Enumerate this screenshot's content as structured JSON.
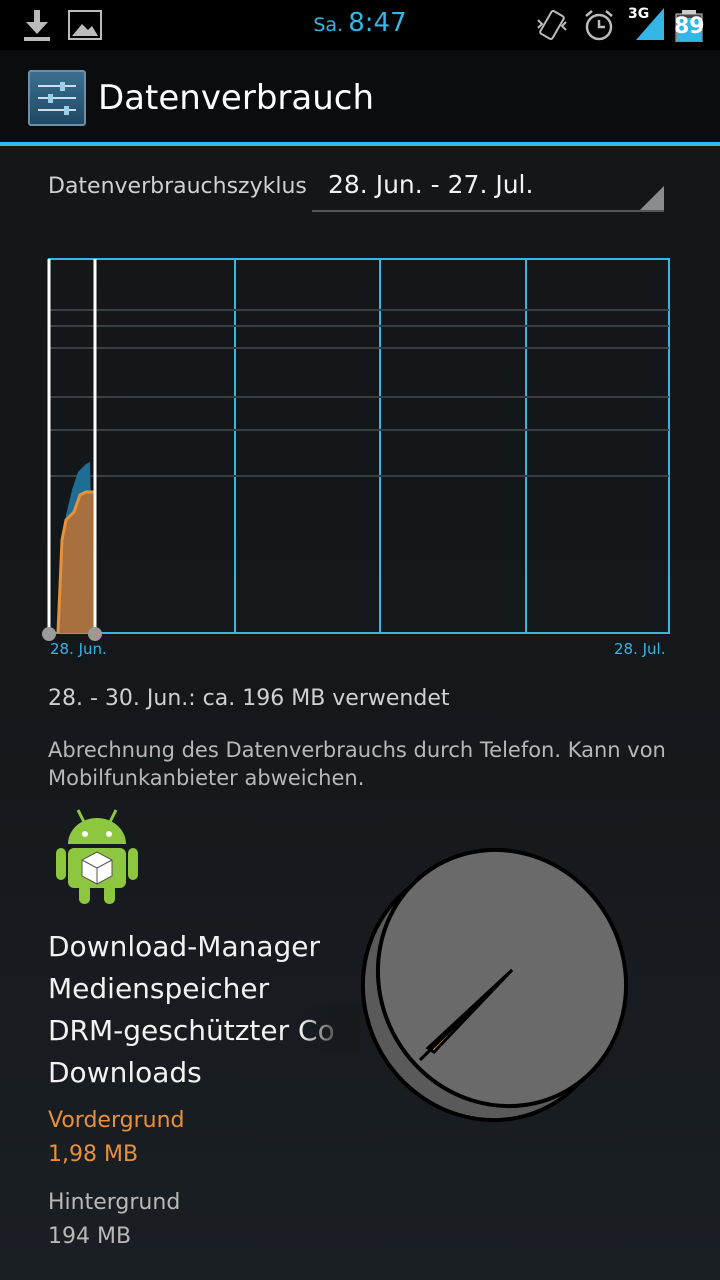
{
  "status_bar": {
    "day": "Sa.",
    "time": "8:47",
    "network": "3G",
    "battery": "89",
    "icons": [
      "download-icon",
      "image-icon",
      "vibrate-icon",
      "alarm-icon",
      "signal-icon",
      "battery-icon"
    ]
  },
  "action_bar": {
    "title": "Datenverbrauch",
    "icon": "settings-sliders-icon"
  },
  "cycle": {
    "label": "Datenverbrauchszyklus",
    "value": "28. Jun. - 27. Jul."
  },
  "chart_data": {
    "type": "area",
    "x_start_label": "28. Jun.",
    "x_end_label": "28. Jul.",
    "series": [
      {
        "name": "",
        "color": "#e8903a"
      },
      {
        "name": "",
        "color": "#1e6d95"
      }
    ],
    "selection": {
      "start": "28. Jun.",
      "end": "30. Jun."
    },
    "grid": true
  },
  "usage_summary": "28. - 30. Jun.: ca. 196 MB verwendet",
  "note": "Abrechnung des Datenverbrauchs durch Telefon. Kann von Mobilfunkanbieter abweichen.",
  "app": {
    "icon": "android-icon",
    "names": [
      "Download-Manager",
      "Medienspeicher",
      "DRM-geschützter Co",
      "Downloads"
    ]
  },
  "foreground": {
    "label": "Vordergrund",
    "value": "1,98 MB"
  },
  "background": {
    "label": "Hintergrund",
    "value": "194 MB"
  },
  "pie": {
    "icon": "usage-pie-icon"
  },
  "colors": {
    "accent": "#33b5e5",
    "foreground": "#e8903a",
    "background_series": "#1e6d95"
  }
}
